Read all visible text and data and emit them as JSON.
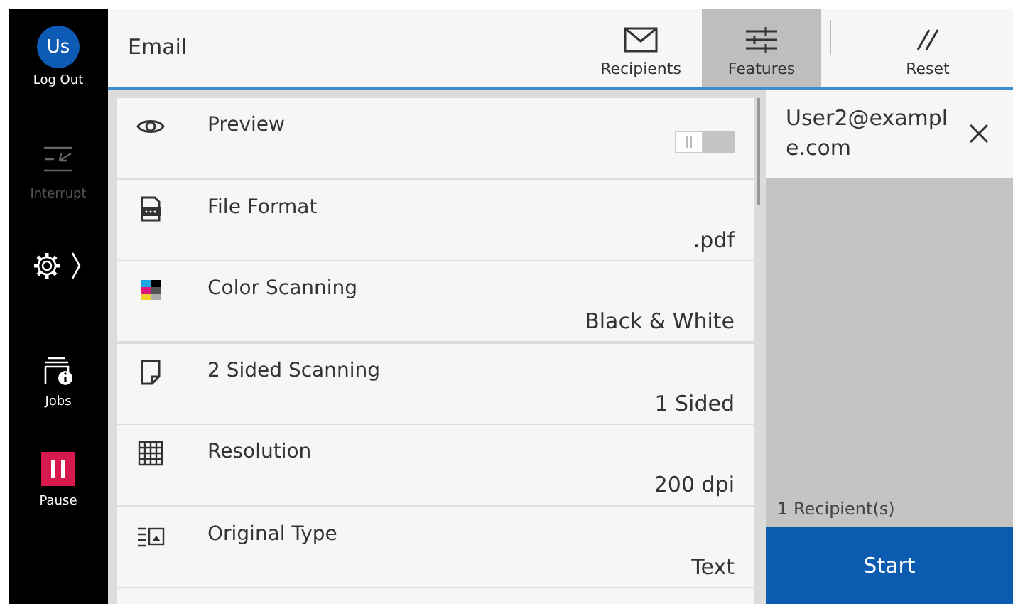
{
  "sidebar": {
    "user": {
      "initials": "Us",
      "label": "Log Out"
    },
    "items": [
      {
        "kind": "interrupt",
        "label": "Interrupt",
        "disabled": true
      },
      {
        "kind": "settings",
        "disabled": false
      },
      {
        "kind": "jobs",
        "label": "Jobs",
        "disabled": false
      },
      {
        "kind": "pause",
        "label": "Pause",
        "disabled": false
      }
    ]
  },
  "header": {
    "title": "Email",
    "tabs": [
      {
        "label": "Recipients",
        "selected": false
      },
      {
        "label": "Features",
        "selected": true
      }
    ],
    "reset": {
      "label": "Reset"
    }
  },
  "features": [
    {
      "kind": "toggle",
      "label": "Preview",
      "on": false
    },
    {
      "kind": "value",
      "label": "File Format",
      "value": ".pdf"
    },
    {
      "kind": "value",
      "label": "Color Scanning",
      "value": "Black & White"
    },
    {
      "kind": "value",
      "label": "2 Sided Scanning",
      "value": "1 Sided"
    },
    {
      "kind": "value",
      "label": "Resolution",
      "value": "200 dpi"
    },
    {
      "kind": "value",
      "label": "Original Type",
      "value": "Text"
    }
  ],
  "recipients": {
    "items": [
      {
        "address": "User2@example.com"
      }
    ],
    "count": "1 Recipient(s)",
    "start": "Start"
  }
}
